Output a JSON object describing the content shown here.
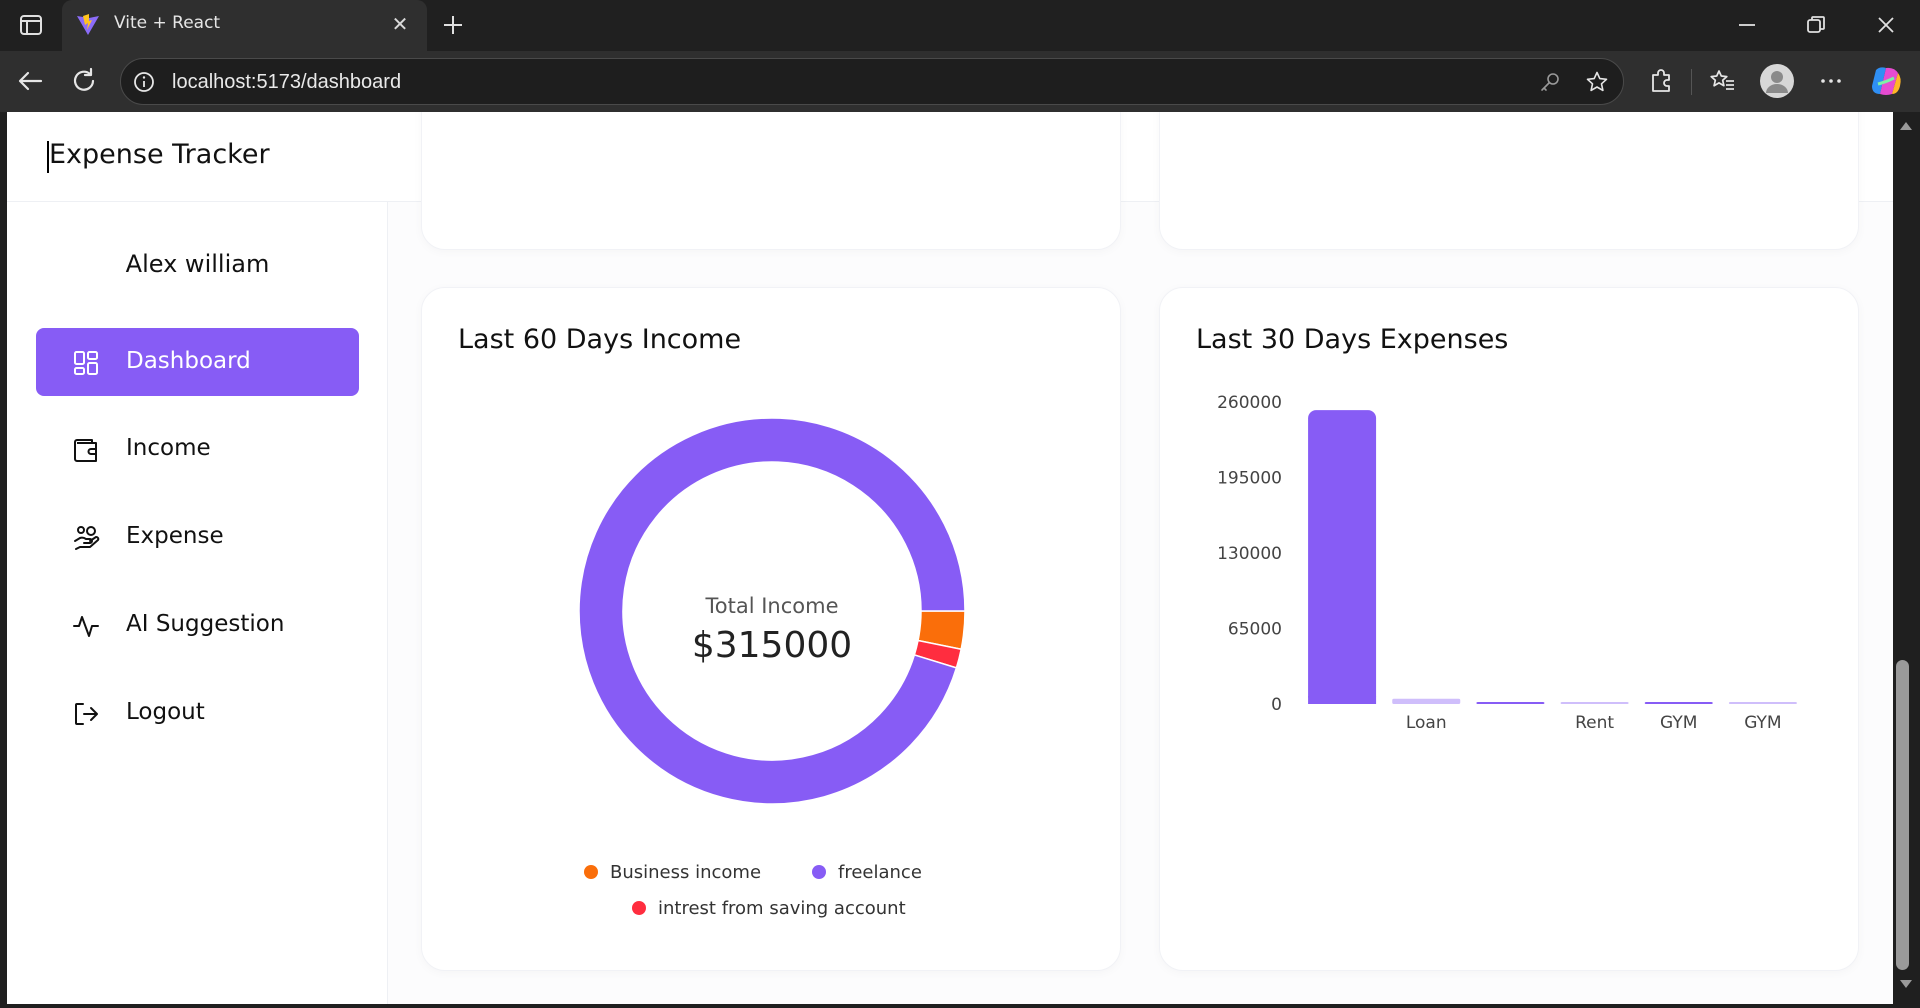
{
  "browser": {
    "tab_title": "Vite + React",
    "url": "localhost:5173/dashboard"
  },
  "app": {
    "brand": "Expense Tracker",
    "user_name": "Alex william"
  },
  "sidebar": {
    "items": [
      {
        "label": "Dashboard",
        "icon": "dashboard-grid-icon",
        "active": true
      },
      {
        "label": "Income",
        "icon": "wallet-icon",
        "active": false
      },
      {
        "label": "Expense",
        "icon": "hand-coins-icon",
        "active": false
      },
      {
        "label": "AI Suggestion",
        "icon": "activity-pulse-icon",
        "active": false
      },
      {
        "label": "Logout",
        "icon": "logout-icon",
        "active": false
      }
    ]
  },
  "income_card": {
    "title": "Last 60 Days Income",
    "center_label": "Total Income",
    "center_value": "$315000"
  },
  "expense_card": {
    "title": "Last 30 Days Expenses"
  },
  "colors": {
    "primary": "#875cf5",
    "orange": "#fa6e0a",
    "red": "#ff2d3f",
    "light_purple": "#cfbefb"
  },
  "chart_data": [
    {
      "type": "pie",
      "title": "Last 60 Days Income",
      "donut": true,
      "labels": [
        "freelance",
        "Business income",
        "intrest from saving account"
      ],
      "values": [
        300000,
        10000,
        5000
      ],
      "colors": [
        "#875cf5",
        "#fa6e0a",
        "#ff2d3f"
      ],
      "legend": [
        {
          "label": "Business income",
          "color": "#fa6e0a"
        },
        {
          "label": "freelance",
          "color": "#875cf5"
        },
        {
          "label": "intrest from saving account",
          "color": "#ff2d3f"
        }
      ]
    },
    {
      "type": "bar",
      "title": "Last 30 Days Expenses",
      "categories": [
        "",
        "Loan",
        "",
        "Rent",
        "GYM",
        "GYM"
      ],
      "values": [
        253000,
        4500,
        1500,
        500,
        900,
        300
      ],
      "bar_colors": [
        "#875cf5",
        "#cfbefb",
        "#875cf5",
        "#cfbefb",
        "#875cf5",
        "#cfbefb"
      ],
      "yticks": [
        "0",
        "65000",
        "130000",
        "195000",
        "260000"
      ],
      "ylim": [
        0,
        260000
      ]
    }
  ]
}
